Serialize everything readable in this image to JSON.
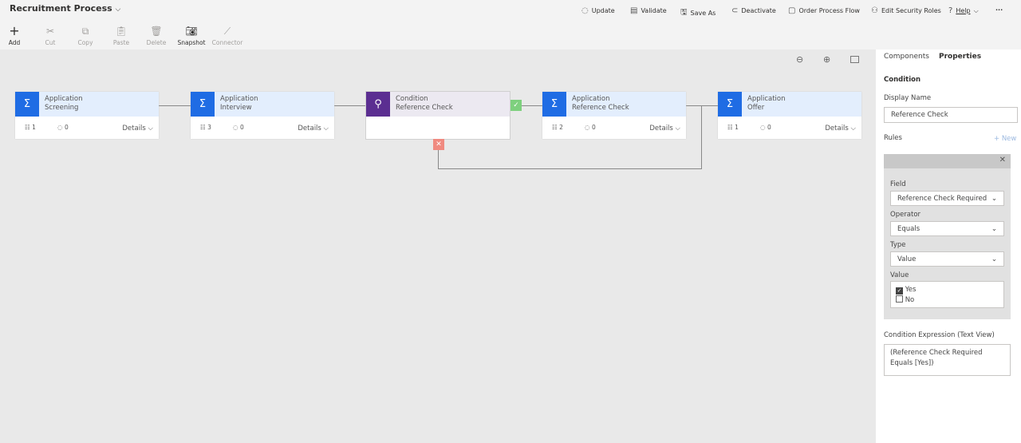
{
  "header": {
    "title": "Recruitment Process"
  },
  "toolbar": {
    "add": "Add",
    "cut": "Cut",
    "copy": "Copy",
    "paste": "Paste",
    "delete": "Delete",
    "snapshot": "Snapshot",
    "connector": "Connector"
  },
  "commands": {
    "update": "Update",
    "validate": "Validate",
    "save_as": "Save As",
    "deactivate": "Deactivate",
    "order": "Order Process Flow",
    "security": "Edit Security Roles",
    "help": "Help",
    "more": "···"
  },
  "stages": [
    {
      "line1": "Application",
      "line2": "Screening",
      "steps": "1",
      "loops": "0",
      "details": "Details"
    },
    {
      "line1": "Application",
      "line2": "Interview",
      "steps": "3",
      "loops": "0",
      "details": "Details"
    },
    {
      "line1": "Condition",
      "line2": "Reference Check"
    },
    {
      "line1": "Application",
      "line2": "Reference Check",
      "steps": "2",
      "loops": "0",
      "details": "Details"
    },
    {
      "line1": "Application",
      "line2": "Offer",
      "steps": "1",
      "loops": "0",
      "details": "Details"
    }
  ],
  "panel": {
    "tab_components": "Components",
    "tab_properties": "Properties",
    "section": "Condition",
    "display_name_label": "Display Name",
    "display_name": "Reference Check",
    "rules_label": "Rules",
    "new": "+ New",
    "field_label": "Field",
    "field": "Reference Check Required",
    "operator_label": "Operator",
    "operator": "Equals",
    "type_label": "Type",
    "type": "Value",
    "value_label": "Value",
    "opt_yes": "Yes",
    "opt_no": "No",
    "expr_label": "Condition Expression (Text View)",
    "expr": "(Reference Check Required Equals [Yes])"
  },
  "colors": {
    "stage": "#1f6ce4",
    "condition": "#5b2e91",
    "true": "#7ed07e",
    "false": "#f08a80"
  }
}
